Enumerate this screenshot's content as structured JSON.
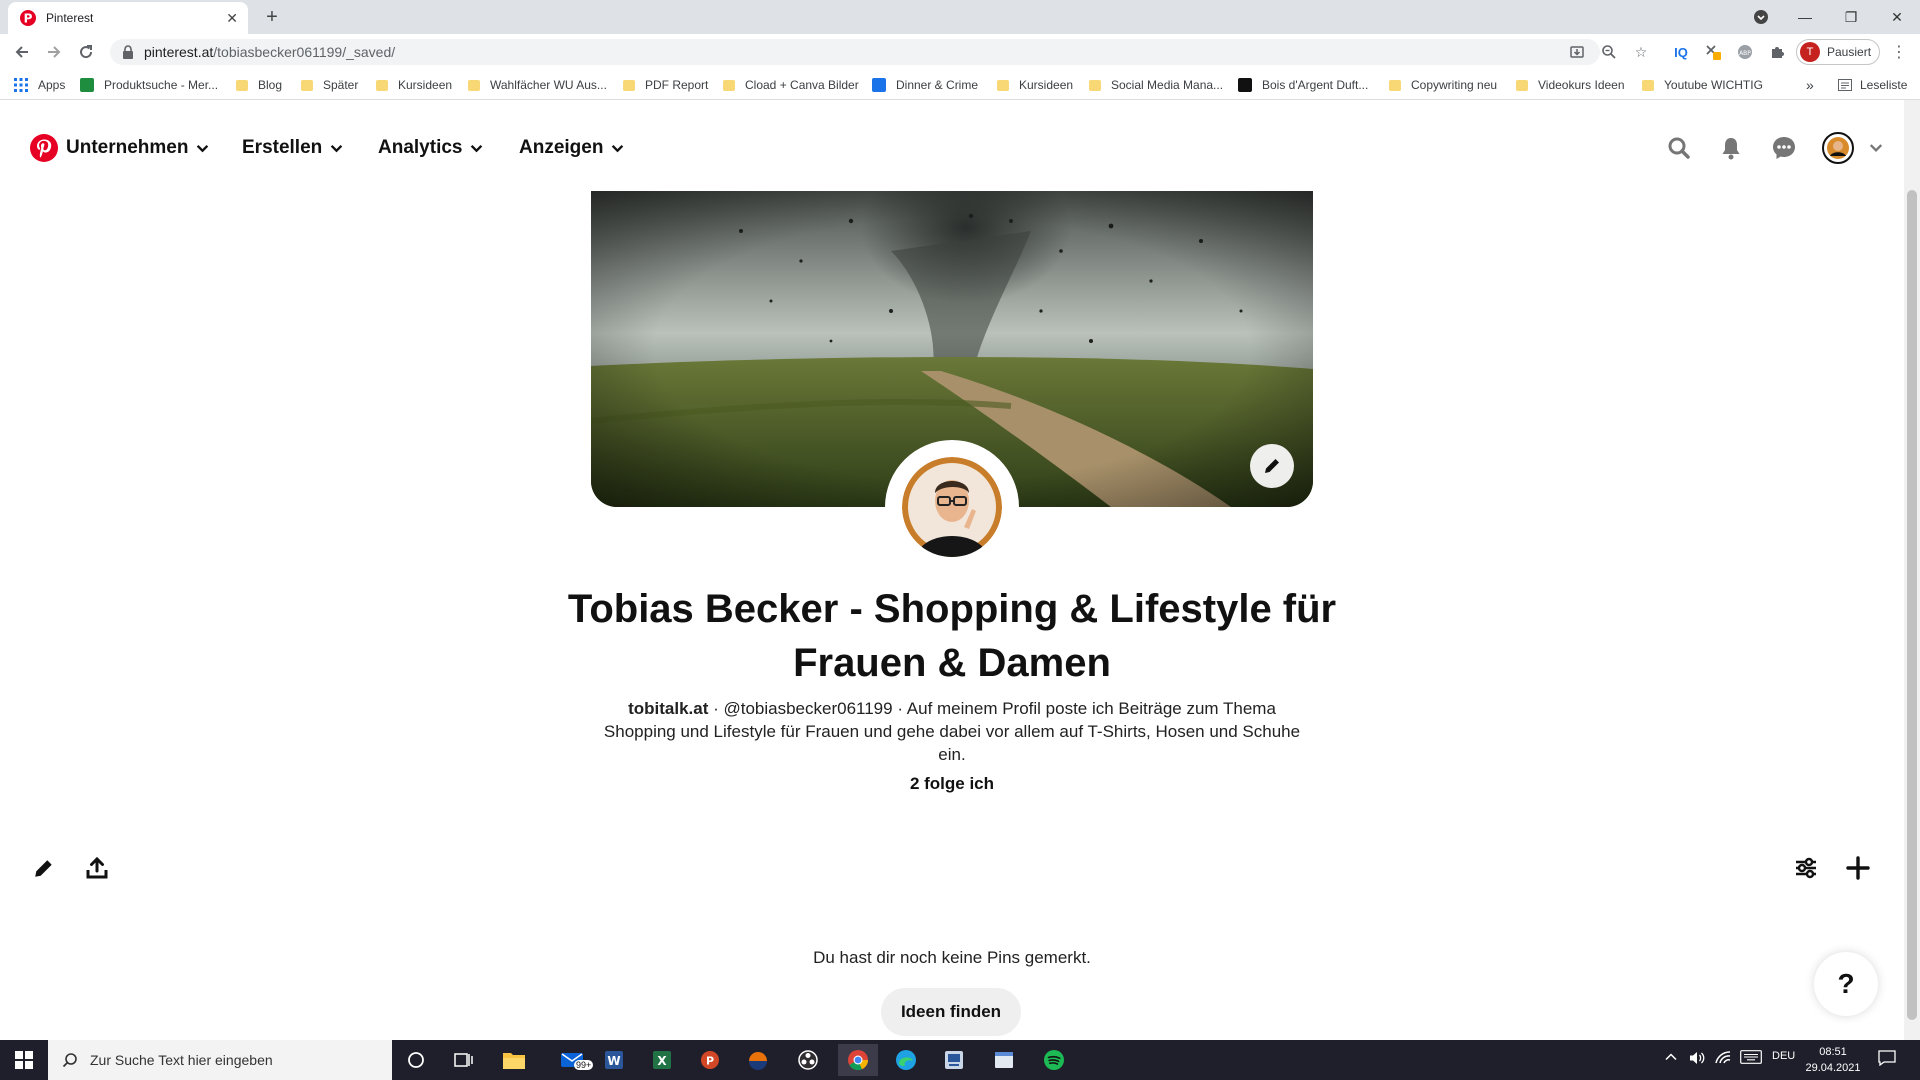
{
  "browser": {
    "tab_title": "Pinterest",
    "url_host": "pinterest.at",
    "url_path": "/tobiasbecker061199/_saved/",
    "profile_initial": "T",
    "profile_label": "Pausiert",
    "bookmarks": [
      "Apps",
      "Produktsuche - Mer...",
      "Blog",
      "Später",
      "Kursideen",
      "Wahlfächer WU Aus...",
      "PDF Report",
      "Cload + Canva Bilder",
      "Dinner & Crime",
      "Kursideen",
      "Social Media Mana...",
      "Bois d'Argent Duft...",
      "Copywriting neu",
      "Videokurs Ideen",
      "Youtube WICHTIG"
    ],
    "bookmarks_more": "»",
    "reading_list": "Leseliste"
  },
  "pinterest": {
    "nav": {
      "business": "Unternehmen",
      "create": "Erstellen",
      "analytics": "Analytics",
      "ads": "Anzeigen"
    },
    "profile": {
      "name": "Tobias Becker - Shopping & Lifestyle für Frauen & Damen",
      "website": "tobitalk.at",
      "separator": " · ",
      "username": "@tobiasbecker061199",
      "about": "Auf meinem Profil poste ich Beiträge zum Thema Shopping und Lifestyle für Frauen und gehe dabei vor allem auf T-Shirts, Hosen und Schuhe ein.",
      "following": "2 folge ich"
    },
    "empty_message": "Du hast dir noch keine Pins gemerkt.",
    "find_ideas": "Ideen finden",
    "help": "?"
  },
  "taskbar": {
    "search_placeholder": "Zur Suche Text hier eingeben",
    "mail_badge": "99+",
    "language": "DEU",
    "time": "08:51",
    "date": "29.04.2021"
  },
  "colors": {
    "pinterest_red": "#e60023",
    "text": "#111111",
    "button_grey": "#efefef"
  }
}
